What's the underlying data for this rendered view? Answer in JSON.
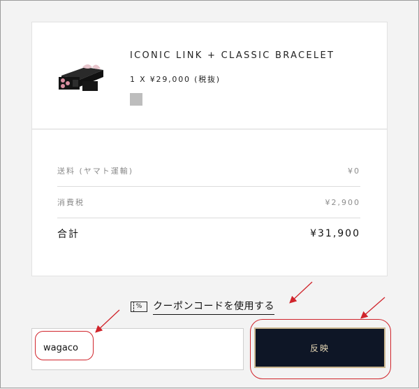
{
  "product": {
    "name": "ICONIC LINK + CLASSIC BRACELET",
    "quantity_price": "1 X ¥29,000 (税抜)",
    "image_icon": "product-gift-box",
    "swatch_color": "#bdbdbd"
  },
  "summary": {
    "shipping_label": "送料 (ヤマト運輸)",
    "shipping_value": "¥0",
    "tax_label": "消費税",
    "tax_value": "¥2,900",
    "total_label": "合計",
    "total_value": "¥31,900"
  },
  "coupon": {
    "icon": "coupon-percent-icon",
    "icon_glyph": "%",
    "toggle_label": "クーポンコードを使用する",
    "input_value": "wagaco",
    "apply_label": "反映"
  },
  "colors": {
    "apply_bg": "#0e1626",
    "apply_border": "#cbb790",
    "annotation": "#d0242b"
  }
}
